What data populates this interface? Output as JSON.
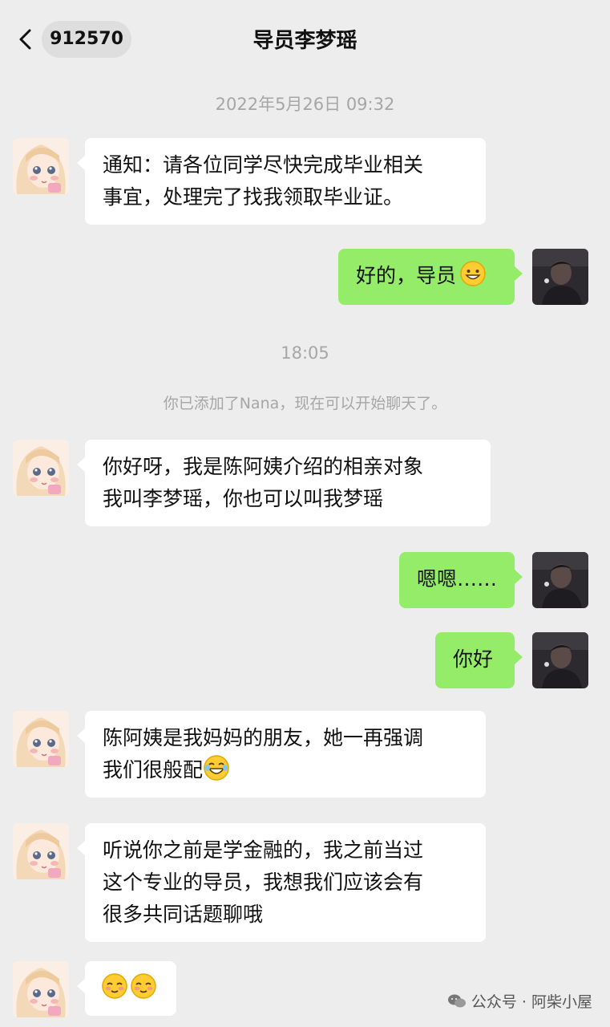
{
  "header": {
    "back_icon": "chevron-left-icon",
    "unread_count": "912570",
    "title": "导员李梦瑶"
  },
  "timestamps": {
    "first": "2022年5月26日 09:32",
    "second": "18:05"
  },
  "system_notice": "你已添加了Nana，现在可以开始聊天了。",
  "messages": [
    {
      "side": "in",
      "lines": [
        "通知：请各位同学尽快完成毕业相关",
        "事宜，处理完了找我领取毕业证。"
      ]
    },
    {
      "side": "out",
      "text": "好的，导员",
      "emoji": "smile-emoji"
    },
    {
      "side": "in",
      "lines": [
        "你好呀，我是陈阿姨介绍的相亲对象",
        "我叫李梦瑶，你也可以叫我梦瑶"
      ]
    },
    {
      "side": "out",
      "text": "嗯嗯……"
    },
    {
      "side": "out",
      "text": "你好"
    },
    {
      "side": "in",
      "lines": [
        "陈阿姨是我妈妈的朋友，她一再强调",
        "我们很般配"
      ],
      "emoji": "laugh-emoji"
    },
    {
      "side": "in",
      "lines": [
        "听说你之前是学金融的，我之前当过",
        "这个专业的导员，我想我们应该会有",
        "很多共同话题聊哦"
      ]
    },
    {
      "side": "in",
      "emojis": [
        "blush-emoji",
        "blush-emoji"
      ]
    }
  ],
  "avatars": {
    "contact": "anime-girl-avatar",
    "self": "dark-photo-avatar"
  },
  "watermark": {
    "icon": "wechat-icon",
    "text": "公众号 · 阿柴小屋"
  },
  "colors": {
    "background": "#ededed",
    "incoming_bubble": "#ffffff",
    "outgoing_bubble": "#95ec69",
    "system_text": "#a6a6a6"
  }
}
